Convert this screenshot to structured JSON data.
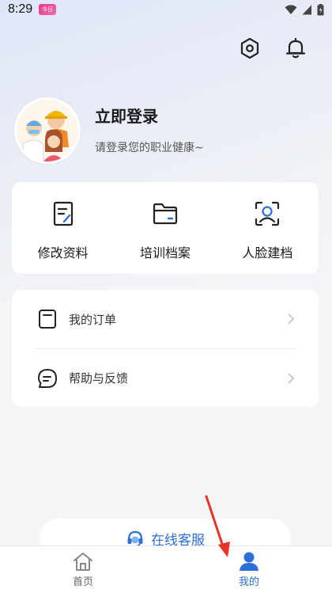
{
  "status_bar": {
    "time": "8:29",
    "app_badge": "今日"
  },
  "profile": {
    "title": "立即登录",
    "subtitle": "请登录您的职业健康~"
  },
  "features": [
    {
      "label": "修改资料",
      "icon": "edit-document-icon"
    },
    {
      "label": "培训档案",
      "icon": "folder-icon"
    },
    {
      "label": "人脸建档",
      "icon": "face-scan-icon"
    }
  ],
  "menu": [
    {
      "label": "我的订单",
      "icon": "order-icon"
    },
    {
      "label": "帮助与反馈",
      "icon": "feedback-chat-icon"
    }
  ],
  "service": {
    "label": "在线客服",
    "icon": "headset-icon"
  },
  "tabs": [
    {
      "label": "首页",
      "icon": "home-icon",
      "active": false
    },
    {
      "label": "我的",
      "icon": "user-icon",
      "active": true
    }
  ],
  "colors": {
    "accent": "#2d6fd8",
    "arrow": "#e8332b"
  }
}
